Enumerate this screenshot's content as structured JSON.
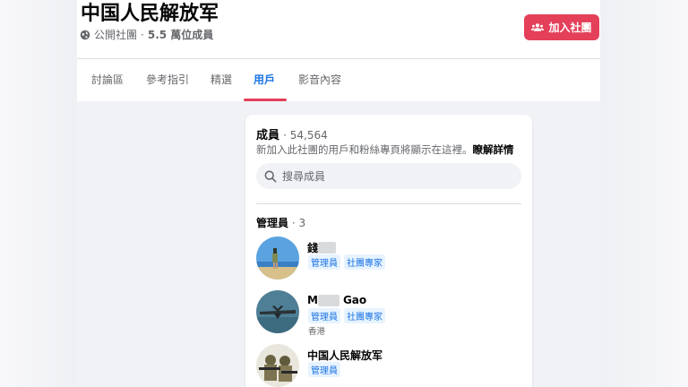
{
  "group": {
    "title": "中国人民解放军",
    "privacy": "公開社團",
    "separator": "·",
    "member_count_short": "5.5 萬位成員",
    "join_label": "加入社團"
  },
  "tabs": [
    {
      "label": "討論區",
      "active": false
    },
    {
      "label": "參考指引",
      "active": false
    },
    {
      "label": "精選",
      "active": false
    },
    {
      "label": "用戶",
      "active": true
    },
    {
      "label": "影音內容",
      "active": false
    }
  ],
  "members": {
    "heading": "成員",
    "count": "· 54,564",
    "description": "新加入此社團的用戶和粉絲專頁將顯示在這裡。",
    "learn_more": "瞭解詳情",
    "search_placeholder": "搜尋成員"
  },
  "admins": {
    "heading": "管理員",
    "count": "· 3",
    "list": [
      {
        "name": "錢",
        "badges": [
          "管理員",
          "社團專家"
        ],
        "location": ""
      },
      {
        "name_prefix": "M",
        "name_suffix": "Gao",
        "badges": [
          "管理員",
          "社團專家"
        ],
        "location": "香港"
      },
      {
        "name": "中国人民解放军",
        "badges": [
          "管理員"
        ],
        "location": ""
      }
    ]
  },
  "colors": {
    "accent_blue": "#1b74e4",
    "join_red": "#e4405a",
    "badge_bg": "#e7f3ff",
    "page_gray": "#f0f2f5"
  },
  "icons": {
    "privacy": "globe-icon",
    "join": "people-icon",
    "search": "search-icon"
  }
}
